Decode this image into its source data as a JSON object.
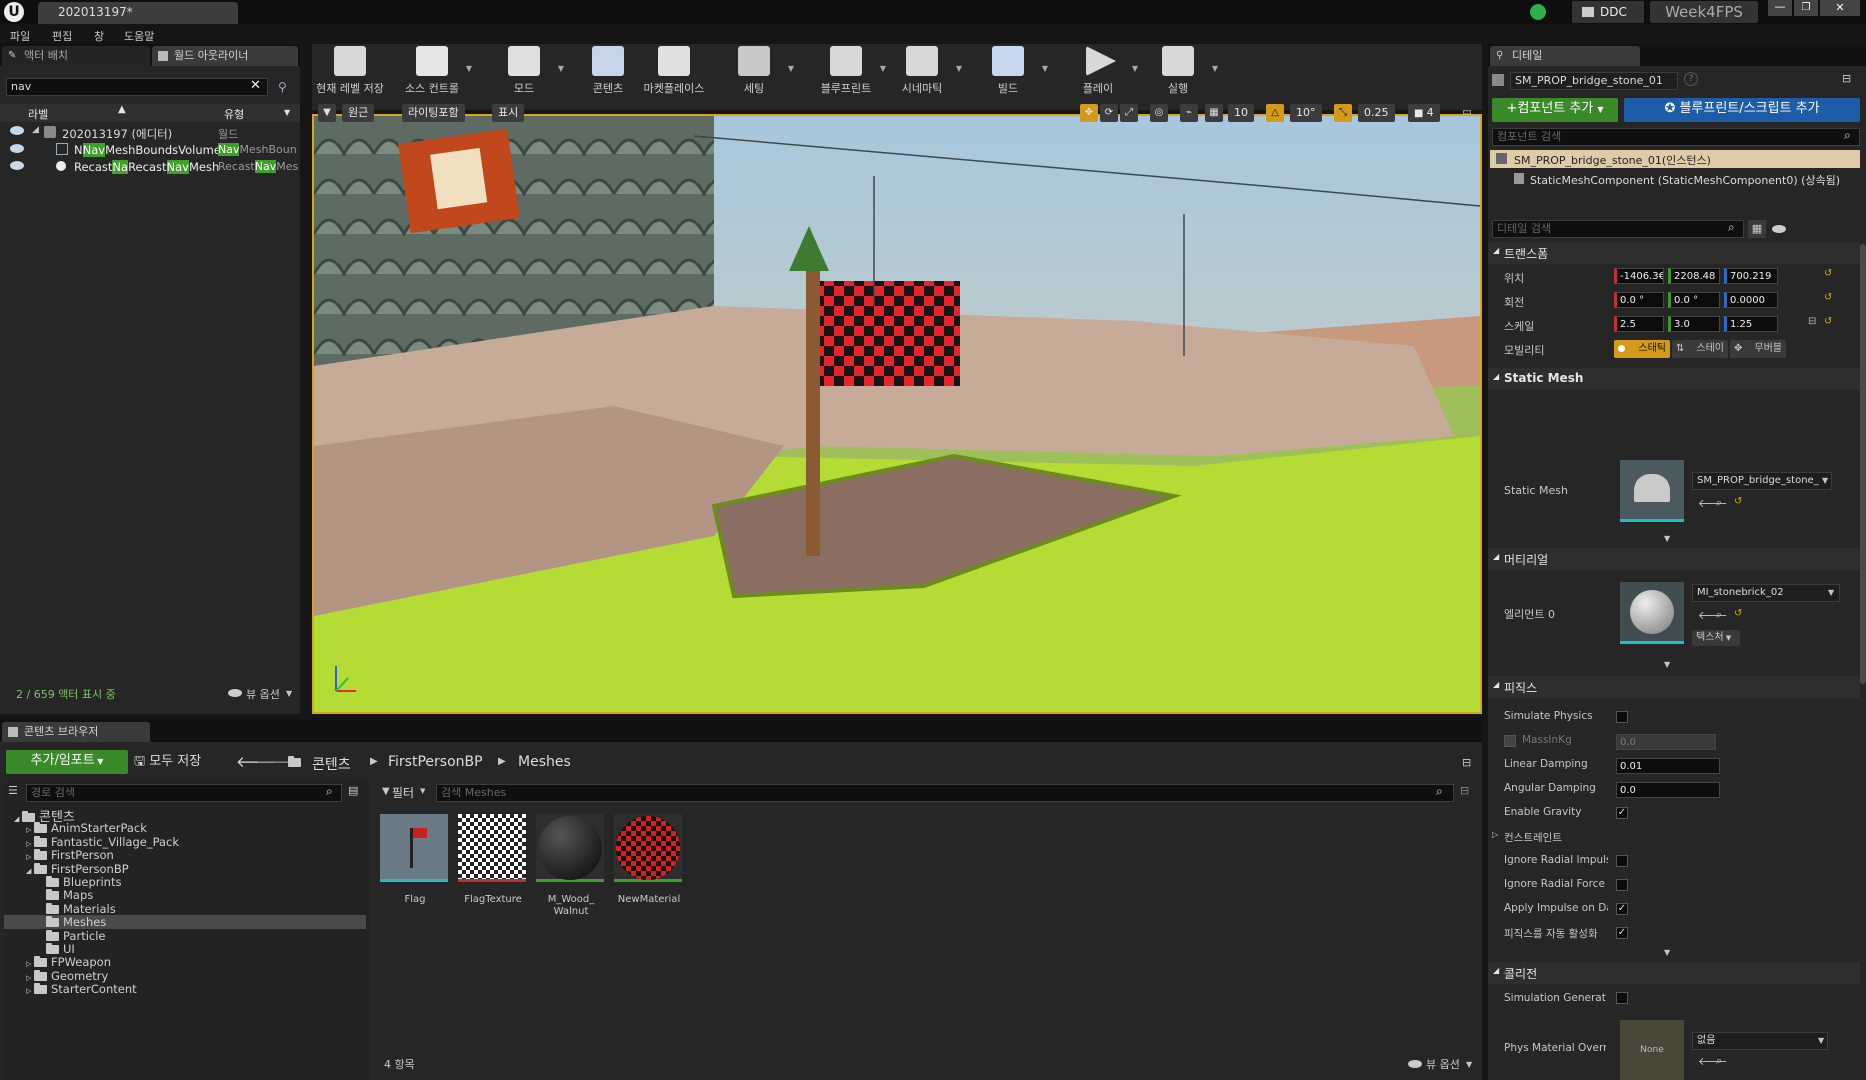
{
  "title_bar": {
    "doc_tab": "202013197*",
    "ddc_label": "DDC",
    "project_name": "Week4FPS"
  },
  "menu": [
    "파일",
    "편집",
    "창",
    "도움말"
  ],
  "left_tabs": {
    "place_actors": "액터 배치",
    "world_outliner": "월드 아웃라이너"
  },
  "outliner": {
    "search_value": "nav",
    "col_label": "라벨",
    "col_type": "유형",
    "items": [
      {
        "name": "202013197 (에디터)",
        "type": "월드"
      },
      {
        "pre": "N",
        "hl": "Nav",
        "post": "MeshBoundsVolume",
        "type_hl": "Nav",
        "type_post": "MeshBoun"
      },
      {
        "pre": "Recast",
        "hl": "Na",
        "mid": "Recast",
        "hl2": "Nav",
        "post": "Mesh",
        "type_pre": "Recast",
        "type_hl": "Nav",
        "type_post": "Mes"
      }
    ],
    "status": "2 / 659 액터 표시 중",
    "view_options": "뷰 옵션"
  },
  "toolbar": [
    {
      "label": "현재 레벨 저장",
      "icon": "save-icon"
    },
    {
      "label": "소스 컨트롤",
      "icon": "source-control-icon"
    },
    {
      "label": "모드",
      "icon": "modes-icon"
    },
    {
      "label": "콘텐츠",
      "icon": "content-icon"
    },
    {
      "label": "마켓플레이스",
      "icon": "marketplace-icon"
    },
    {
      "label": "세팅",
      "icon": "settings-icon"
    },
    {
      "label": "블루프린트",
      "icon": "blueprint-icon"
    },
    {
      "label": "시네마틱",
      "icon": "cinematics-icon"
    },
    {
      "label": "빌드",
      "icon": "build-icon"
    },
    {
      "label": "플레이",
      "icon": "play-icon"
    },
    {
      "label": "실행",
      "icon": "launch-icon"
    }
  ],
  "viewport": {
    "perspective": "원근",
    "lit": "라이팅포함",
    "show": "표시",
    "grid_snap": "10",
    "rot_snap": "10°",
    "scale_snap": "0.25",
    "cam_speed": "4"
  },
  "details": {
    "tab": "디테일",
    "actor_name": "SM_PROP_bridge_stone_01",
    "add_component": "+컴포넌트 추가",
    "add_blueprint": "블루프린트/스크립트 추가",
    "component_search": "컴포넌트 검색",
    "instance_row": "SM_PROP_bridge_stone_01(인스턴스)",
    "component_row": "StaticMeshComponent (StaticMeshComponent0) (상속됨)",
    "detail_search": "디테일 검색",
    "transform_header": "트랜스폼",
    "location_label": "위치",
    "rotation_label": "회전",
    "scale_label": "스케일",
    "mobility_label": "모빌리티",
    "location": [
      "-1406.3€",
      "2208.48",
      "700.219"
    ],
    "rotation": [
      "0.0 °",
      "0.0 °",
      "0.0000"
    ],
    "scale": [
      "2.5",
      "3.0",
      "1.25"
    ],
    "mobility": [
      "스태틱",
      "스테이",
      "무버블"
    ],
    "static_mesh_header": "Static Mesh",
    "static_mesh_label": "Static Mesh",
    "static_mesh_value": "SM_PROP_bridge_stone_",
    "materials_header": "머티리얼",
    "element_label": "엘리먼트 0",
    "material_value": "MI_stonebrick_02",
    "textures_btn": "텍스처",
    "physics_header": "피직스",
    "physics_rows": [
      {
        "label": "Simulate Physics",
        "checked": false
      },
      {
        "label": "MassInKg",
        "value": "0.0"
      },
      {
        "label": "Linear Damping",
        "value": "0.01"
      },
      {
        "label": "Angular Damping",
        "value": "0.0"
      },
      {
        "label": "Enable Gravity",
        "checked": true
      },
      {
        "label": "컨스트레인트"
      },
      {
        "label": "Ignore Radial Impulse",
        "checked": false
      },
      {
        "label": "Ignore Radial Force",
        "checked": false
      },
      {
        "label": "Apply Impulse on Dar",
        "checked": true
      },
      {
        "label": "피직스를 자동 활성화",
        "checked": true
      }
    ],
    "collision_header": "콜리전",
    "sim_gen_label": "Simulation Generates",
    "phys_mat_label": "Phys Material Overri",
    "phys_mat_thumb": "None",
    "phys_mat_value": "없음"
  },
  "content_browser": {
    "tab": "콘텐츠 브라우저",
    "add_import": "추가/임포트",
    "save_all": "모두 저장",
    "crumbs": [
      "콘텐츠",
      "FirstPersonBP",
      "Meshes"
    ],
    "path_search": "경로 검색",
    "filter": "필터",
    "search_placeholder": "검색 Meshes",
    "tree": [
      {
        "label": "콘텐츠",
        "level": 0,
        "expanded": true
      },
      {
        "label": "AnimStarterPack",
        "level": 1
      },
      {
        "label": "Fantastic_Village_Pack",
        "level": 1
      },
      {
        "label": "FirstPerson",
        "level": 1
      },
      {
        "label": "FirstPersonBP",
        "level": 1,
        "expanded": true
      },
      {
        "label": "Blueprints",
        "level": 2
      },
      {
        "label": "Maps",
        "level": 2
      },
      {
        "label": "Materials",
        "level": 2
      },
      {
        "label": "Meshes",
        "level": 2,
        "selected": true
      },
      {
        "label": "Particle",
        "level": 2
      },
      {
        "label": "UI",
        "level": 2
      },
      {
        "label": "FPWeapon",
        "level": 1
      },
      {
        "label": "Geometry",
        "level": 1
      },
      {
        "label": "StarterContent",
        "level": 1
      }
    ],
    "assets": [
      "Flag",
      "FlagTexture",
      "M_Wood_\nWalnut",
      "NewMaterial"
    ],
    "count": "4 항목",
    "view_options": "뷰 옵션"
  }
}
